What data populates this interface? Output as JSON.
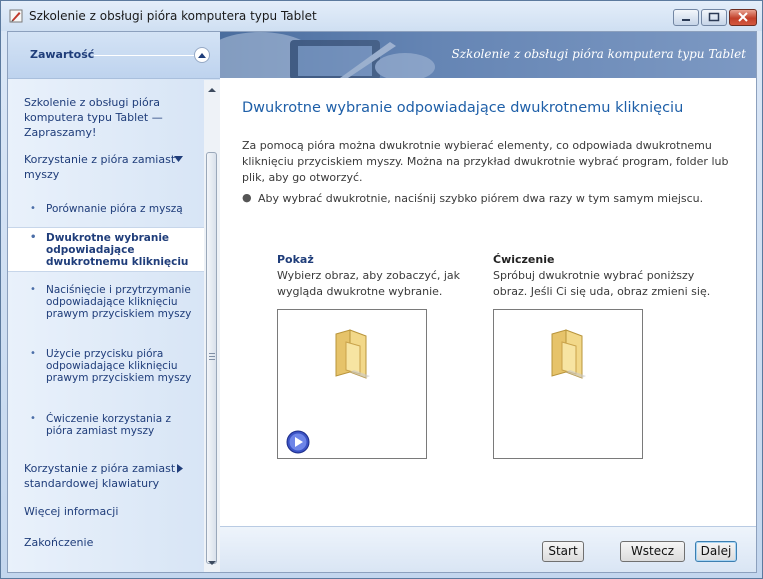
{
  "window": {
    "title": "Szkolenie z obsługi pióra komputera typu Tablet"
  },
  "sidebar": {
    "header_label": "Zawartość",
    "items": [
      {
        "label": "Szkolenie z obsługi pióra komputera typu Tablet — Zapraszamy!"
      },
      {
        "label": "Korzystanie z pióra zamiast myszy",
        "state": "expanded"
      },
      {
        "label": "Porównanie pióra z myszą"
      },
      {
        "label": "Dwukrotne wybranie odpowiadające dwukrotnemu kliknięciu",
        "selected": true
      },
      {
        "label": "Naciśnięcie i przytrzymanie odpowiadające kliknięciu prawym przyciskiem myszy"
      },
      {
        "label": "Użycie przycisku pióra odpowiadające kliknięciu prawym przyciskiem myszy"
      },
      {
        "label": "Ćwiczenie korzystania z pióra zamiast myszy"
      },
      {
        "label": "Korzystanie z pióra zamiast standardowej klawiatury",
        "state": "collapsed"
      },
      {
        "label": "Więcej informacji"
      },
      {
        "label": "Zakończenie"
      }
    ]
  },
  "banner": {
    "text": "Szkolenie z obsługi pióra komputera typu Tablet"
  },
  "main": {
    "heading": "Dwukrotne wybranie odpowiadające dwukrotnemu kliknięciu",
    "intro": "Za pomocą pióra można dwukrotnie wybierać elementy, co odpowiada dwukrotnemu kliknięciu przyciskiem myszy. Można na przykład dwukrotnie wybrać program, folder lub plik, aby go otworzyć.",
    "bullet": "Aby wybrać dwukrotnie, naciśnij szybko piórem dwa razy w tym samym miejscu.",
    "show": {
      "title": "Pokaż",
      "description": "Wybierz obraz, aby zobaczyć, jak wygląda dwukrotne wybranie."
    },
    "exercise": {
      "title": "Ćwiczenie",
      "description": "Spróbuj dwukrotnie wybrać poniższy obraz. Jeśli Ci się uda, obraz zmieni się."
    }
  },
  "footer": {
    "start_label": "Start",
    "back_label": "Wstecz",
    "next_label": "Dalej"
  },
  "colors": {
    "accent": "#1e5fa8",
    "nav_text": "#1f3d7a",
    "banner": "#5a7bad"
  }
}
